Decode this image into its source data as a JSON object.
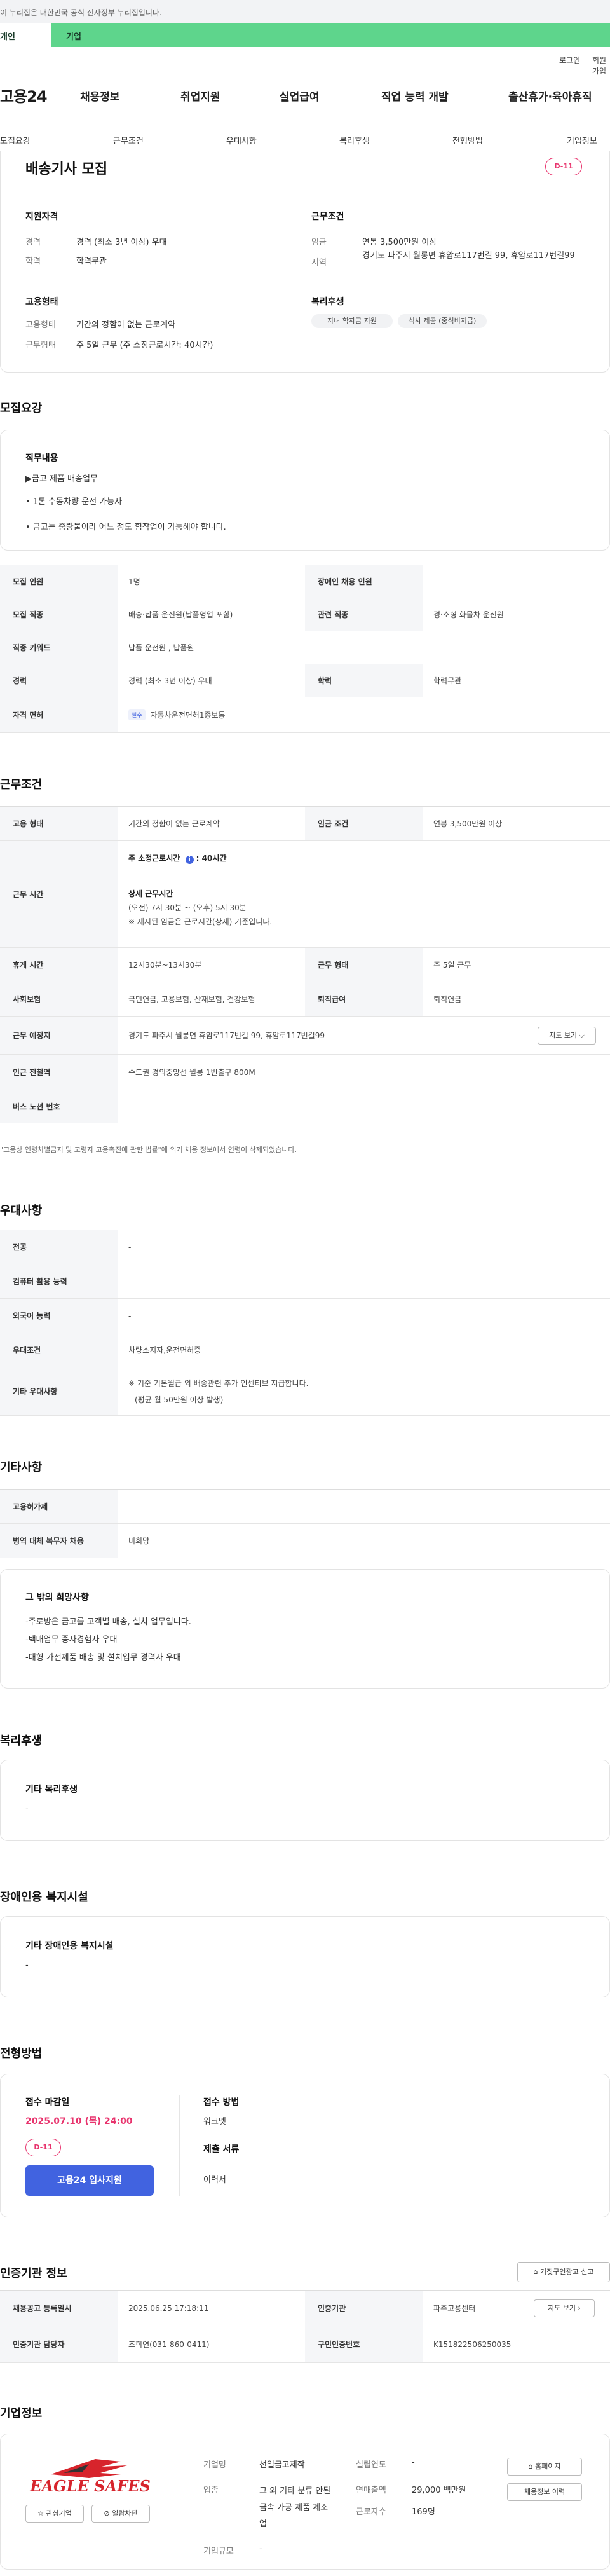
{
  "gov": {
    "notice": "이 누리집은 대한민국 공식 전자정부 누리집입니다."
  },
  "green": {
    "left": "개인",
    "right": "기업"
  },
  "util": {
    "login": "로그인",
    "join": "회원가입"
  },
  "logo": "고용24",
  "gnb": [
    "채용정보",
    "취업지원",
    "실업급여",
    "직업 능력 개발",
    "출산휴가·육아휴직"
  ],
  "tabs": [
    "모집요강",
    "근무조건",
    "우대사항",
    "복리후생",
    "전형방법",
    "기업정보"
  ],
  "job": {
    "title": "배송기사 모집",
    "dday": "D-11",
    "qual_head": "지원자격",
    "career_lbl": "경력",
    "career_val": "경력 (최소 3년 이상) 우대",
    "edu_lbl": "학력",
    "edu_val": "학력무관",
    "cond_head": "근무조건",
    "wage_lbl": "임금",
    "wage_val": "연봉 3,500만원 이상",
    "region_lbl": "지역",
    "region_val": "경기도 파주시 월롱면 휴암로117번길 99, 휴암로117번길99",
    "emp_head": "고용형태",
    "emptype_lbl": "고용형태",
    "emptype_val": "기간의 정함이 없는 근로계약",
    "worktype_lbl": "근무형태",
    "worktype_val": "주 5일 근무 (주 소정근로시간: 40시간)",
    "welfare_head": "복리후생",
    "welfare_tags": [
      "자녀 학자금 지원",
      "식사 제공 (중식비지급)"
    ]
  },
  "recruit": {
    "title": "모집요강",
    "duty_head": "직무내용",
    "duty_lines": [
      "▶금고 제품 배송업무",
      "• 1톤 수동차량 운전 가능자",
      "• 금고는 중량물이라 어느 정도 힘작업이 가능해야 합니다."
    ],
    "rows": [
      [
        "모집 인원",
        "1명",
        "장애인 채용 인원",
        "-"
      ],
      [
        "모집 직종",
        "배송·납품 운전원(납품영업 포함)",
        "관련 직종",
        "경·소형 화물차 운전원"
      ],
      [
        "직종 키워드",
        "납품 운전원 , 납품원"
      ],
      [
        "경력",
        "경력 (최소 3년 이상) 우대",
        "학력",
        "학력무관"
      ],
      [
        "자격 면허",
        "필수",
        "자동차운전면허1종보통"
      ]
    ]
  },
  "work": {
    "title": "근무조건",
    "r1": [
      "고용 형태",
      "기간의 정함이 없는 근로계약",
      "임금 조건",
      "연봉 3,500만원 이상"
    ],
    "hours_lbl": "근무 시간",
    "hours_main": "주 소정근로시간 ",
    "hours_bold": "40시간",
    "hours_detail_head": "상세 근무시간",
    "hours_detail": "(오전) 7시 30분 ~ (오후) 5시 30분",
    "hours_note": "※ 제시된 임금은 근로시간(상세) 기준입니다.",
    "r3": [
      "휴게 시간",
      "12시30분~13시30분",
      "근무 형태",
      "주 5일 근무"
    ],
    "r4": [
      "사회보험",
      "국민연금, 고용보험, 산재보험, 건강보험",
      "퇴직급여",
      "퇴직연금"
    ],
    "r5": [
      "근무 예정지",
      "경기도 파주시 월롱면 휴암로117번길 99, 휴암로117번길99"
    ],
    "map_btn": "지도 보기",
    "r6": [
      "인근 전철역",
      "수도권 경의중앙선 월롱 1번출구 800M"
    ],
    "r7": [
      "버스 노선 번호",
      "-"
    ],
    "note": "\"고용상 연령차별금지 및 고령자 고용촉진에 관한 법률\"에 의거 채용 정보에서 연령이 삭제되었습니다."
  },
  "pref": {
    "title": "우대사항",
    "rows": [
      [
        "전공",
        "-"
      ],
      [
        "컴퓨터 활용 능력",
        "-"
      ],
      [
        "외국어 능력",
        "-"
      ],
      [
        "우대조건",
        "차량소지자,운전면허증"
      ],
      [
        "기타 우대사항",
        "※ 기준 기본월급 외 배송관련 추가 인센티브 지급합니다.",
        "(평균 월 50만원 이상 발생)"
      ]
    ]
  },
  "etc": {
    "title": "기타사항",
    "rows": [
      [
        "고용허가제",
        "-"
      ],
      [
        "병역 대체 복무자 채용",
        "비희망"
      ]
    ],
    "wish_head": "그 밖의 희망사항",
    "wish_lines": [
      "-주로방은 금고를 고객별 배송, 설치 업무입니다.",
      "-택배업무 종사경험자 우대",
      "-대형 가전제품 배송 및 설치업무 경력자 우대"
    ]
  },
  "benefit": {
    "title": "복리후생",
    "head": "기타 복리후생",
    "val": "-"
  },
  "disab": {
    "title": "장애인용 복지시설",
    "head": "기타 장애인용 복지시설",
    "val": "-"
  },
  "select": {
    "title": "전형방법",
    "deadline_head": "접수 마감일",
    "deadline": "2025.07.10 (목) 24:00",
    "dday": "D-11",
    "apply": "고용24 입사지원",
    "method_head": "접수 방법",
    "method": "워크넷",
    "docs_head": "제출 서류",
    "docs": "이력서"
  },
  "agency": {
    "title": "인증기관 정보",
    "report_btn": "거짓구인광고 신고",
    "map_btn": "지도 보기",
    "r1": [
      "채용공고 등록일시",
      "2025.06.25 17:18:11",
      "인증기관",
      "파주고용센터"
    ],
    "r2": [
      "인증기관 담당자",
      "조희연(031-860-0411)",
      "구인인증번호",
      "K151822506250035"
    ]
  },
  "company": {
    "title": "기업정보",
    "logo_text": "EAGLE SAFES",
    "fav": "관심기업",
    "block": "열람차단",
    "name_lbl": "기업명",
    "name": "선일금고제작",
    "year_lbl": "설립연도",
    "year": "-",
    "ind_lbl": "업종",
    "ind": "그 외 기타 분류 안된 금속 가공 제품 제조업",
    "sales_lbl": "연매출액",
    "sales": "29,000 백만원",
    "emp_lbl": "근로자수",
    "emp": "169명",
    "size_lbl": "기업규모",
    "size": "-",
    "home_btn": "홈페이지",
    "jobs_btn": "채용정보 이력",
    "brand": "#d7242c"
  }
}
